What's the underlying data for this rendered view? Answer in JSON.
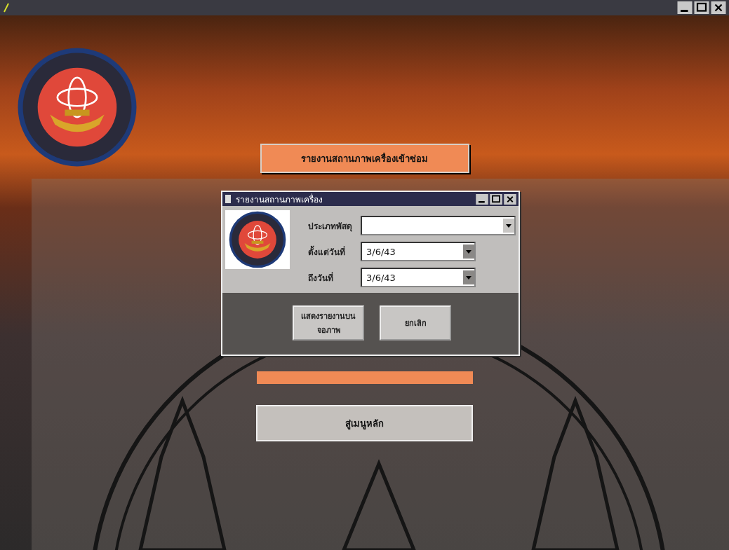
{
  "header_button": {
    "label": "รายงานสถานภาพเครื่องเข้าซ่อม"
  },
  "dialog": {
    "title": "รายงานสถานภาพเครื่อง",
    "fields": [
      {
        "kind": "combo",
        "label": "ประเภทพัสดุ"
      },
      {
        "kind": "date",
        "label": "ตั้งแต่วันที่",
        "value": "3/6/43"
      },
      {
        "kind": "date",
        "label": "ถึงวันที่",
        "value": "3/6/43"
      }
    ],
    "buttons": [
      {
        "lines": [
          "แสดงรายงานบน",
          "จอภาพ"
        ]
      },
      {
        "lines": [
          "ยกเลิก"
        ]
      }
    ]
  },
  "main_menu_button": {
    "label": "สู่เมนูหลัก"
  }
}
